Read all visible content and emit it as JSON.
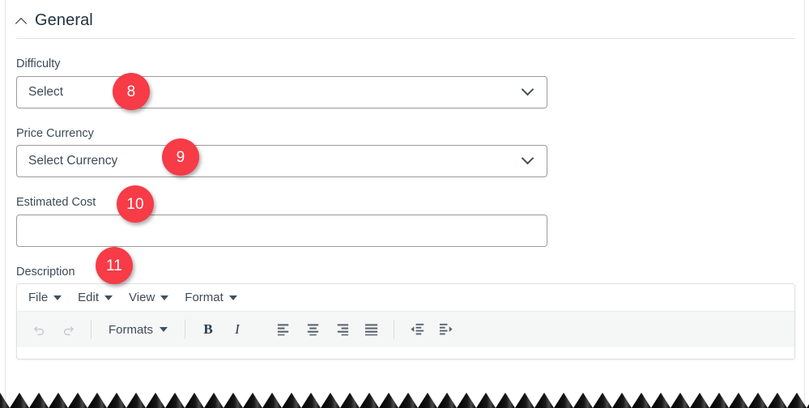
{
  "section": {
    "title": "General",
    "collapse_icon": "chevron-up-icon"
  },
  "fields": [
    {
      "label": "Difficulty",
      "value": "Select",
      "type": "select",
      "icon": "chevron-down-icon",
      "badge": "8"
    },
    {
      "label": "Price Currency",
      "value": "Select Currency",
      "type": "select",
      "icon": "chevron-down-icon",
      "badge": "9"
    },
    {
      "label": "Estimated Cost",
      "value": "",
      "type": "text",
      "icon": "",
      "badge": "10"
    }
  ],
  "description": {
    "label": "Description",
    "badge": "11",
    "menubar": [
      {
        "label": "File",
        "icon": "caret-down-icon"
      },
      {
        "label": "Edit",
        "icon": "caret-down-icon"
      },
      {
        "label": "View",
        "icon": "caret-down-icon"
      },
      {
        "label": "Format",
        "icon": "caret-down-icon"
      }
    ],
    "toolbar": {
      "undo": "undo-icon",
      "redo": "redo-icon",
      "formats_label": "Formats",
      "formats_icon": "caret-down-icon",
      "bold": "B",
      "italic": "I",
      "align_left": "align-left-icon",
      "align_center": "align-center-icon",
      "align_right": "align-right-icon",
      "align_justify": "align-justify-icon",
      "outdent": "outdent-icon",
      "indent": "indent-icon"
    }
  },
  "colors": {
    "badge_red": "#f73b47",
    "label_text": "#3d4a57",
    "title_text": "#22303f",
    "field_border": "#9a9a9a",
    "toolbar_bg": "#f5f6f6",
    "divider": "#e3e3e3"
  }
}
